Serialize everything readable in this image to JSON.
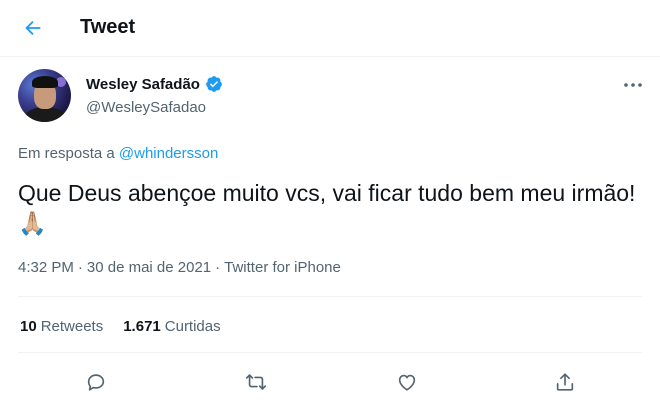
{
  "header": {
    "title": "Tweet",
    "back_icon": "arrow-left-icon"
  },
  "author": {
    "display_name": "Wesley Safadão",
    "handle": "@WesleySafadao",
    "verified": true,
    "verified_icon": "verified-badge-icon"
  },
  "more_icon": "more-horizontal-icon",
  "reply": {
    "prefix": "Em resposta a",
    "handle": "@whindersson"
  },
  "tweet": {
    "text": "Que Deus abençoe muito vcs, vai ficar tudo bem meu irmão! 🙏🏼"
  },
  "meta": {
    "time": "4:32 PM",
    "separator": "·",
    "date": "30 de mai de 2021",
    "source": "Twitter for iPhone"
  },
  "stats": {
    "retweets_count": "10",
    "retweets_label": "Retweets",
    "likes_count": "1.671",
    "likes_label": "Curtidas"
  },
  "actions": [
    "reply-icon",
    "retweet-icon",
    "like-icon",
    "share-icon"
  ],
  "colors": {
    "accent": "#1d9bf0",
    "text": "#0f1419",
    "secondary": "#536471",
    "divider": "#eff3f4"
  }
}
